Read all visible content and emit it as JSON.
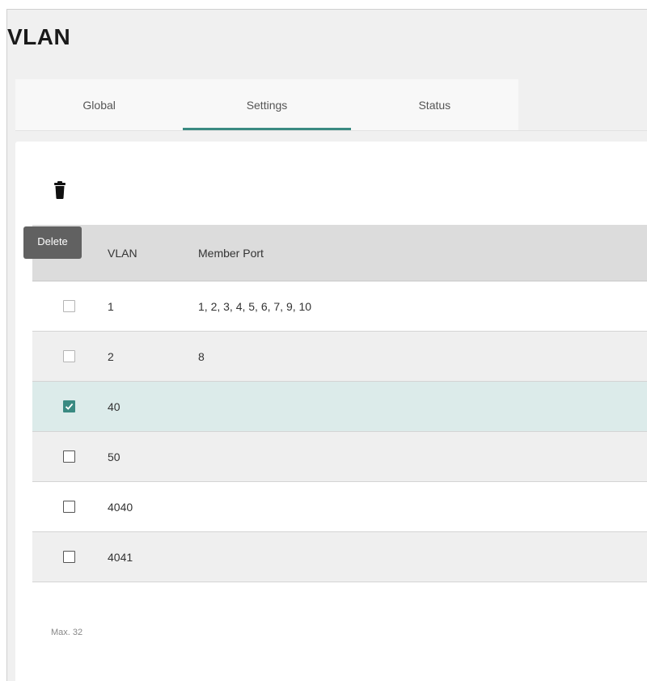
{
  "page": {
    "title": "VLAN"
  },
  "tabs": [
    {
      "label": "Global",
      "active": false
    },
    {
      "label": "Settings",
      "active": true
    },
    {
      "label": "Status",
      "active": false
    }
  ],
  "toolbar": {
    "delete_icon": "trash-icon",
    "delete_tooltip": "Delete"
  },
  "table": {
    "columns": [
      "VLAN",
      "Member Port"
    ],
    "rows": [
      {
        "vlan": "1",
        "member_port": "1, 2, 3, 4, 5, 6, 7, 9, 10",
        "checked": false,
        "disabled": true
      },
      {
        "vlan": "2",
        "member_port": "8",
        "checked": false,
        "disabled": true
      },
      {
        "vlan": "40",
        "member_port": "",
        "checked": true,
        "disabled": false
      },
      {
        "vlan": "50",
        "member_port": "",
        "checked": false,
        "disabled": false
      },
      {
        "vlan": "4040",
        "member_port": "",
        "checked": false,
        "disabled": false
      },
      {
        "vlan": "4041",
        "member_port": "",
        "checked": false,
        "disabled": false
      }
    ]
  },
  "footer": {
    "max_note": "Max. 32"
  },
  "colors": {
    "accent": "#3a8a82",
    "selected_row": "#dcebea",
    "header_bg": "#dcdcdc",
    "tooltip_bg": "#616161"
  }
}
